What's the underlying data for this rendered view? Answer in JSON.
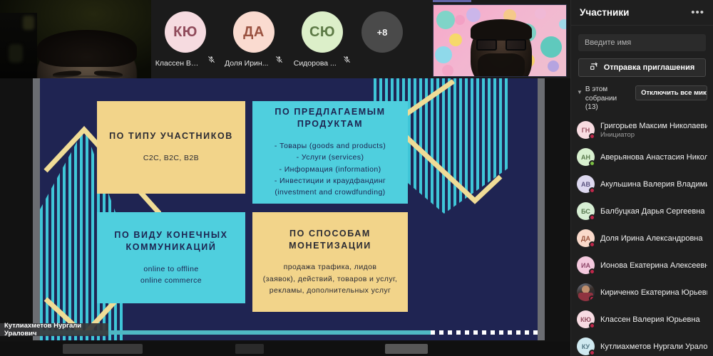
{
  "topbar": {
    "self_name": "self-video",
    "tiles": [
      {
        "initials": "КЮ",
        "name": "Классен Ва...",
        "bg": "#f6dbe0",
        "fg": "#8f4a5a",
        "mic": "muted"
      },
      {
        "initials": "ДА",
        "name": "Доля Ирин...",
        "bg": "#fadbd0",
        "fg": "#9a5240",
        "mic": "muted"
      },
      {
        "initials": "СЮ",
        "name": "Сидорова ...",
        "bg": "#dcefc9",
        "fg": "#5d7a46",
        "mic": "muted"
      }
    ],
    "overflow_label": "+8"
  },
  "slide": {
    "quadrants": [
      {
        "id": "participant-type",
        "title": "ПО ТИПУ УЧАСТНИКОВ",
        "lines": [
          "C2C, B2C, B2B"
        ],
        "color": "yellow"
      },
      {
        "id": "offered-products",
        "title": "ПО ПРЕДЛАГАЕМЫМ ПРОДУКТАМ",
        "lines": [
          "- Товары (goods and products)",
          "- Услуги (services)",
          "- Информация (information)",
          "- Инвестиции и краудфандинг",
          "(investment and crowdfunding)"
        ],
        "color": "cyan"
      },
      {
        "id": "communication-type",
        "title": "ПО ВИДУ КОНЕЧНЫХ КОММУНИКАЦИЙ",
        "lines": [
          "online to offline",
          "online commerce"
        ],
        "color": "cyan"
      },
      {
        "id": "monetization-methods",
        "title": "ПО СПОСОБАМ МОНЕТИЗАЦИИ",
        "lines": [
          "продажа трафика, лидов",
          "(заявок), действий, товаров и услуг,",
          "рекламы, дополнительных услуг"
        ],
        "color": "yellow"
      }
    ],
    "presenter_tag": "Кутлиахметов Нургали Уралович",
    "colors": {
      "navy": "#1f2452",
      "yellow": "#f2d48a",
      "cyan": "#4fcfde",
      "gold": "#f0dc96"
    }
  },
  "panel": {
    "title": "Участники",
    "more_label": "•••",
    "search_placeholder": "Введите имя",
    "invite_label": "Отправка приглашения",
    "section_label": "В этом собрании (13)",
    "mute_all_label": "Отключить все микро",
    "participants": [
      {
        "initials": "ГН",
        "name": "Григорьев Максим Николаевич",
        "role": "Инициатор",
        "bg": "#f8dce1",
        "fg": "#9a5262",
        "status": "#c0274a"
      },
      {
        "initials": "АН",
        "name": "Аверьянова Анастасия Никола..",
        "role": "",
        "bg": "#d8f0cf",
        "fg": "#5a7a4c",
        "status": "#7cc043"
      },
      {
        "initials": "АВ",
        "name": "Акульшина Валерия Владимир..",
        "role": "",
        "bg": "#ddd8ef",
        "fg": "#5b5480",
        "status": "#c0274a"
      },
      {
        "initials": "БС",
        "name": "Балбуцкая Дарья Сергеевна",
        "role": "",
        "bg": "#d7efd4",
        "fg": "#57784f",
        "status": "#c0274a"
      },
      {
        "initials": "ДА",
        "name": "Доля Ирина Александровна",
        "role": "",
        "bg": "#fadacb",
        "fg": "#99533c",
        "status": "#c0274a"
      },
      {
        "initials": "ИА",
        "name": "Ионова Екатерина Алексеевна",
        "role": "",
        "bg": "#f4c9de",
        "fg": "#8d4468",
        "status": "#c0274a"
      },
      {
        "initials": "",
        "name": "Кириченко Екатерина Юрьевна",
        "role": "",
        "bg": "#3a3f52",
        "fg": "#ffffff",
        "status": "#c0274a",
        "photo": true
      },
      {
        "initials": "КЮ",
        "name": "Классен Валерия Юрьевна",
        "role": "",
        "bg": "#f7dbe2",
        "fg": "#8f4a5c",
        "status": "#c0274a"
      },
      {
        "initials": "КУ",
        "name": "Кутлиахметов Нургали Уралов..",
        "role": "",
        "bg": "#cfe9f0",
        "fg": "#4e7380",
        "status": "#c0274a"
      }
    ]
  }
}
